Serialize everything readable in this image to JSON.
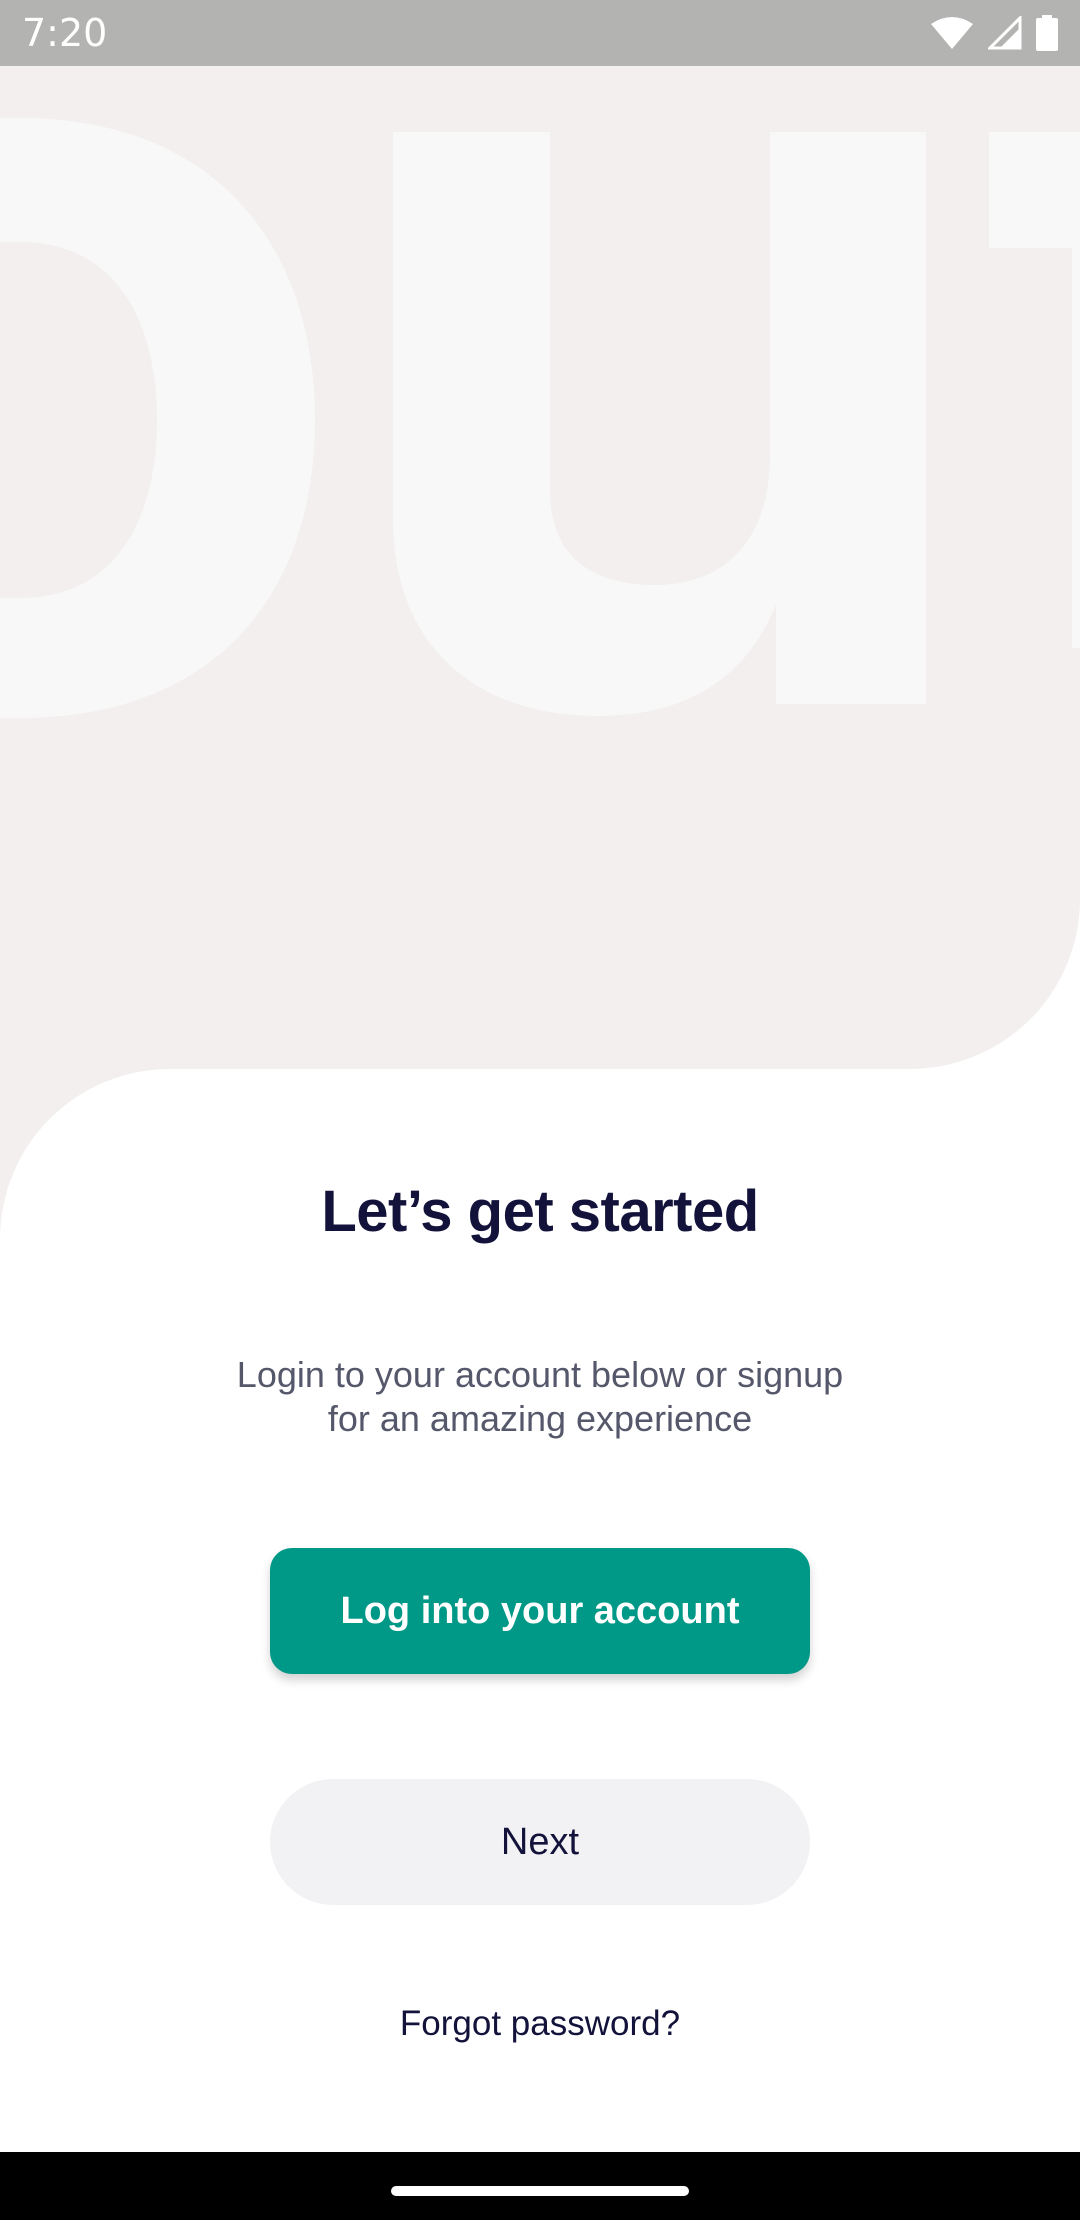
{
  "status_bar": {
    "time": "7:20",
    "icons": [
      "wifi-icon",
      "cellular-signal-icon",
      "battery-icon"
    ]
  },
  "hero": {
    "background_text": "out",
    "background_color": "#f2efee",
    "text_color": "#f8f8f8"
  },
  "main": {
    "title": "Let’s get started",
    "subtitle_line1": "Login to your account below or signup",
    "subtitle_line2": "for an amazing experience",
    "login_button_label": "Log into your account",
    "next_button_label": "Next",
    "forgot_password_label": "Forgot password?"
  },
  "colors": {
    "accent": "#009886",
    "title": "#12123a",
    "subtitle": "#55576a",
    "secondary_button_bg": "#f2f2f4"
  }
}
